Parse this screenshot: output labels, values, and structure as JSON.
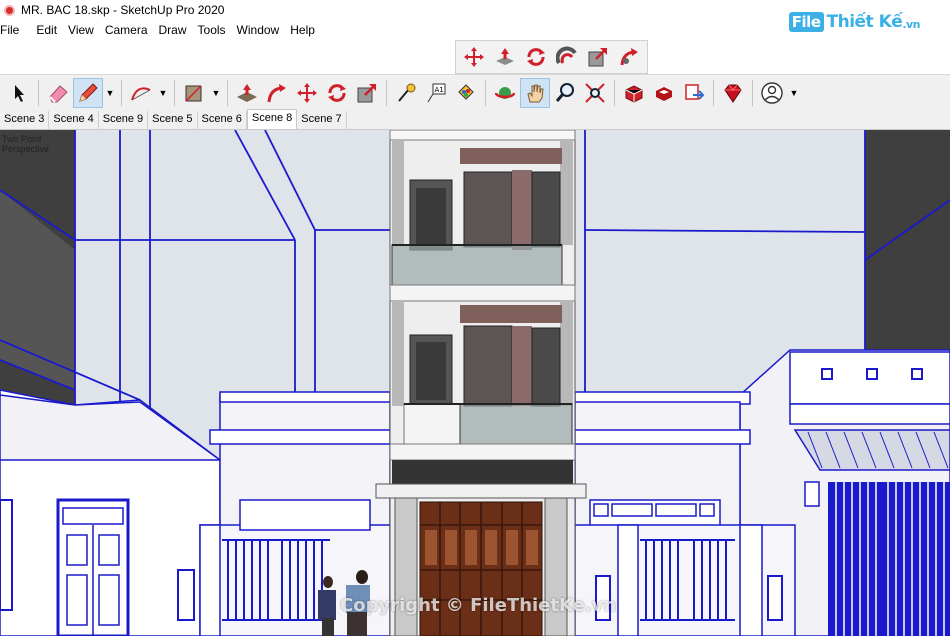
{
  "window": {
    "title": "MR. BAC 18.skp - SketchUp Pro 2020"
  },
  "watermark": {
    "tag": "File",
    "name": "Thiết Kế",
    "tld": ".vn",
    "copyright": "Copyright © FileThietKe.vn"
  },
  "menu": [
    "File",
    "Edit",
    "View",
    "Camera",
    "Draw",
    "Tools",
    "Window",
    "Help"
  ],
  "floating_toolbar": [
    "push-pull-icon",
    "follow-me-icon",
    "rotate-icon",
    "offset-icon",
    "scale-icon",
    "warehouse-icon"
  ],
  "toolbar": {
    "tools": [
      "select-icon",
      "eraser-icon",
      "pencil-icon",
      "arc-icon",
      "rectangle-icon",
      "push-pull-icon",
      "follow-me-icon",
      "move-icon",
      "rotate-icon",
      "scale-icon",
      "tape-measure-icon",
      "text-icon",
      "paint-bucket-icon",
      "orbit-icon",
      "pan-icon",
      "zoom-icon",
      "zoom-extents-icon",
      "3d-warehouse-icon",
      "extension-warehouse-icon",
      "send-to-layout-icon",
      "ruby-icon",
      "account-icon"
    ],
    "active_tool": "pan-icon"
  },
  "scenes": {
    "tabs": [
      "Scene 3",
      "Scene 4",
      "Scene 9",
      "Scene 5",
      "Scene 6",
      "Scene 8",
      "Scene 7"
    ],
    "active": "Scene 8"
  },
  "viewport": {
    "camera_label": "Two Point Perspective"
  },
  "colors": {
    "edge_blue": "#1a1acc",
    "sky": "#dfe4ea",
    "building_dark": "#444444",
    "gate_wood": "#7a3a20",
    "accent": "#3ab0e6"
  }
}
